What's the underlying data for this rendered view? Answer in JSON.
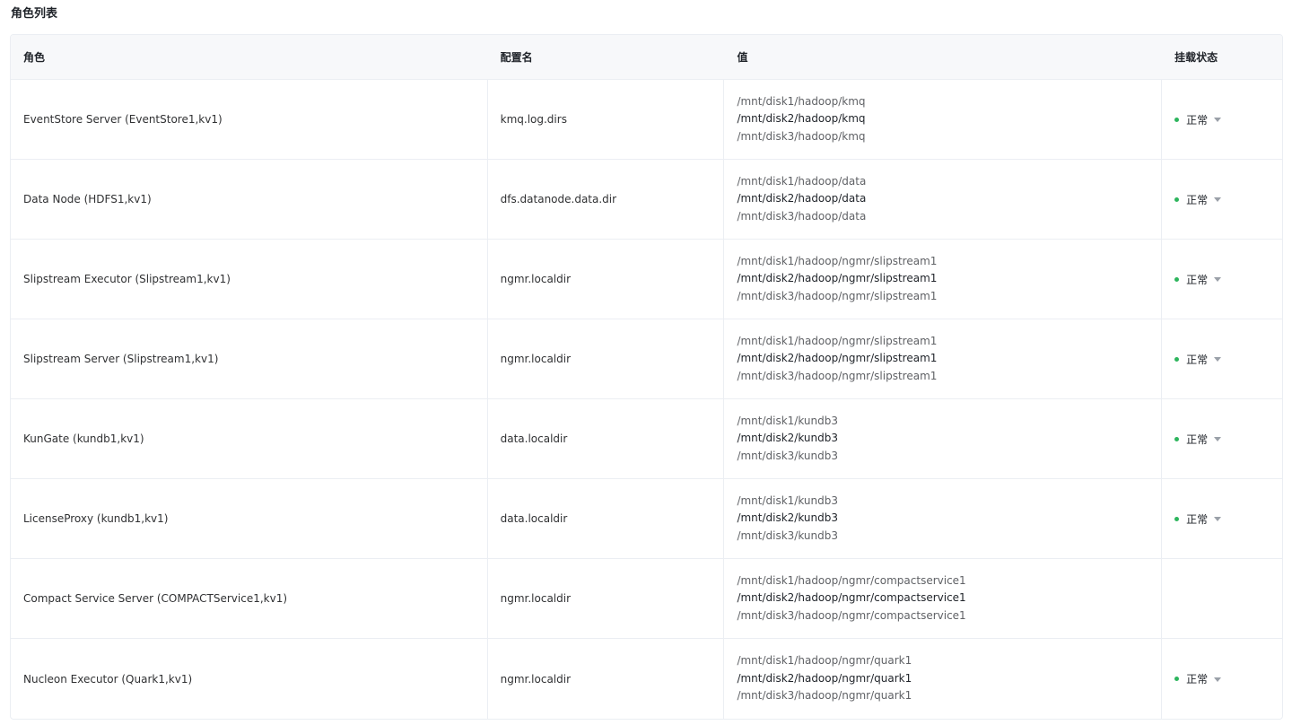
{
  "page_title": "角色列表",
  "table": {
    "headers": {
      "role": "角色",
      "config_name": "配置名",
      "value": "值",
      "mount_status": "挂载状态"
    },
    "rows": [
      {
        "role": "EventStore Server (EventStore1,kv1)",
        "config_name": "kmq.log.dirs",
        "values": [
          "/mnt/disk1/hadoop/kmq",
          "/mnt/disk2/hadoop/kmq",
          "/mnt/disk3/hadoop/kmq"
        ],
        "status": "正常"
      },
      {
        "role": "Data Node (HDFS1,kv1)",
        "config_name": "dfs.datanode.data.dir",
        "values": [
          "/mnt/disk1/hadoop/data",
          "/mnt/disk2/hadoop/data",
          "/mnt/disk3/hadoop/data"
        ],
        "status": "正常"
      },
      {
        "role": "Slipstream Executor (Slipstream1,kv1)",
        "config_name": "ngmr.localdir",
        "values": [
          "/mnt/disk1/hadoop/ngmr/slipstream1",
          "/mnt/disk2/hadoop/ngmr/slipstream1",
          "/mnt/disk3/hadoop/ngmr/slipstream1"
        ],
        "status": "正常"
      },
      {
        "role": "Slipstream Server (Slipstream1,kv1)",
        "config_name": "ngmr.localdir",
        "values": [
          "/mnt/disk1/hadoop/ngmr/slipstream1",
          "/mnt/disk2/hadoop/ngmr/slipstream1",
          "/mnt/disk3/hadoop/ngmr/slipstream1"
        ],
        "status": "正常"
      },
      {
        "role": "KunGate (kundb1,kv1)",
        "config_name": "data.localdir",
        "values": [
          "/mnt/disk1/kundb3",
          "/mnt/disk2/kundb3",
          "/mnt/disk3/kundb3"
        ],
        "status": "正常"
      },
      {
        "role": "LicenseProxy (kundb1,kv1)",
        "config_name": "data.localdir",
        "values": [
          "/mnt/disk1/kundb3",
          "/mnt/disk2/kundb3",
          "/mnt/disk3/kundb3"
        ],
        "status": "正常"
      },
      {
        "role": "Compact Service Server (COMPACTService1,kv1)",
        "config_name": "ngmr.localdir",
        "values": [
          "/mnt/disk1/hadoop/ngmr/compactservice1",
          "/mnt/disk2/hadoop/ngmr/compactservice1",
          "/mnt/disk3/hadoop/ngmr/compactservice1"
        ],
        "status": ""
      },
      {
        "role": "Nucleon Executor (Quark1,kv1)",
        "config_name": "ngmr.localdir",
        "values": [
          "/mnt/disk1/hadoop/ngmr/quark1",
          "/mnt/disk2/hadoop/ngmr/quark1",
          "/mnt/disk3/hadoop/ngmr/quark1"
        ],
        "status": "正常"
      }
    ]
  },
  "colors": {
    "status_ok": "#2db55d",
    "header_bg": "#f7f8fa",
    "border": "#ebeef3"
  },
  "icons": {
    "status_indicator": "green-dot-icon",
    "dropdown": "caret-down-icon"
  }
}
